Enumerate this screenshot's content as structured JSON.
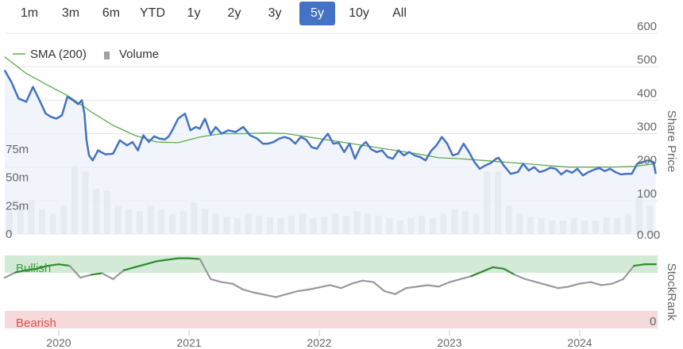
{
  "range_selector": {
    "buttons": [
      {
        "label": "1m",
        "active": false
      },
      {
        "label": "3m",
        "active": false
      },
      {
        "label": "6m",
        "active": false
      },
      {
        "label": "YTD",
        "active": false
      },
      {
        "label": "1y",
        "active": false
      },
      {
        "label": "2y",
        "active": false
      },
      {
        "label": "3y",
        "active": false
      },
      {
        "label": "5y",
        "active": true
      },
      {
        "label": "10y",
        "active": false
      },
      {
        "label": "All",
        "active": false
      }
    ]
  },
  "colors": {
    "price_line": "#4472c4",
    "price_fill": "#eef2fa",
    "sma_line": "#5aaa4a",
    "volume_bar": "#c8c8cc",
    "bullish_band": "#d3ebd6",
    "bearish_band": "#f6d9da",
    "bullish_text": "#3a9a3a",
    "bearish_text": "#d9534f",
    "rank_neutral": "#999999",
    "rank_bullish": "#2e8b2e",
    "grid": "#e6e6e6",
    "axis_text": "#666666"
  },
  "chart_data": [
    {
      "type": "line",
      "x_axis": {
        "ticks": [
          "2020",
          "2021",
          "2022",
          "2023",
          "2024"
        ],
        "range": [
          "2019-08",
          "2024-08"
        ]
      },
      "y_axis_right": {
        "title": "Share Price",
        "range": [
          0,
          600
        ],
        "ticks": [
          "0.00",
          "100",
          "200",
          "300",
          "400",
          "500",
          "600"
        ]
      },
      "y_axis_left": {
        "range": [
          0,
          100000000
        ],
        "ticks": [
          "0",
          "25m",
          "50m",
          "75m"
        ]
      },
      "legend": {
        "placement": "top-left",
        "items": [
          "SMA (200)",
          "Volume"
        ]
      },
      "grid": true,
      "series": [
        {
          "name": "Share Price",
          "kind": "area",
          "x": [
            "2019-08-01",
            "2019-08-20",
            "2019-09-10",
            "2019-10-01",
            "2019-10-20",
            "2019-11-10",
            "2019-11-25",
            "2019-12-10",
            "2019-12-25",
            "2020-01-10",
            "2020-01-25",
            "2020-02-10",
            "2020-02-25",
            "2020-03-05",
            "2020-03-12",
            "2020-03-18",
            "2020-03-25",
            "2020-04-05",
            "2020-04-20",
            "2020-05-10",
            "2020-06-01",
            "2020-06-20",
            "2020-07-10",
            "2020-07-25",
            "2020-08-10",
            "2020-08-25",
            "2020-09-10",
            "2020-09-25",
            "2020-10-10",
            "2020-10-25",
            "2020-11-05",
            "2020-11-15",
            "2020-12-01",
            "2020-12-20",
            "2021-01-05",
            "2021-01-20",
            "2021-02-01",
            "2021-02-15",
            "2021-03-01",
            "2021-03-15",
            "2021-04-01",
            "2021-04-20",
            "2021-05-10",
            "2021-06-01",
            "2021-06-20",
            "2021-07-10",
            "2021-07-25",
            "2021-08-10",
            "2021-08-25",
            "2021-09-10",
            "2021-09-25",
            "2021-10-10",
            "2021-10-25",
            "2021-11-10",
            "2021-11-25",
            "2021-12-10",
            "2021-12-25",
            "2022-01-10",
            "2022-01-25",
            "2022-02-10",
            "2022-02-25",
            "2022-03-10",
            "2022-03-25",
            "2022-04-10",
            "2022-04-25",
            "2022-05-10",
            "2022-05-25",
            "2022-06-10",
            "2022-06-25",
            "2022-07-10",
            "2022-07-25",
            "2022-08-10",
            "2022-08-25",
            "2022-09-10",
            "2022-09-25",
            "2022-10-10",
            "2022-10-25",
            "2022-11-10",
            "2022-11-25",
            "2022-12-10",
            "2022-12-25",
            "2023-01-10",
            "2023-01-25",
            "2023-02-10",
            "2023-02-25",
            "2023-03-10",
            "2023-03-25",
            "2023-04-10",
            "2023-04-25",
            "2023-05-10",
            "2023-05-17",
            "2023-06-01",
            "2023-06-20",
            "2023-07-10",
            "2023-07-25",
            "2023-08-10",
            "2023-08-25",
            "2023-09-10",
            "2023-09-25",
            "2023-10-10",
            "2023-10-25",
            "2023-11-10",
            "2023-11-25",
            "2023-12-10",
            "2023-12-25",
            "2024-01-10",
            "2024-01-25",
            "2024-02-10",
            "2024-02-25",
            "2024-03-10",
            "2024-03-25",
            "2024-04-10",
            "2024-04-25",
            "2024-05-10",
            "2024-05-25",
            "2024-06-10",
            "2024-06-25",
            "2024-07-10",
            "2024-07-25",
            "2024-08-01"
          ],
          "values": [
            490,
            455,
            405,
            395,
            440,
            395,
            360,
            350,
            345,
            355,
            410,
            400,
            388,
            400,
            360,
            280,
            235,
            220,
            250,
            238,
            240,
            280,
            265,
            275,
            250,
            295,
            275,
            292,
            285,
            283,
            292,
            310,
            345,
            360,
            310,
            320,
            315,
            345,
            298,
            320,
            300,
            310,
            305,
            320,
            295,
            285,
            270,
            270,
            275,
            285,
            290,
            285,
            270,
            290,
            282,
            260,
            255,
            280,
            300,
            270,
            273,
            245,
            270,
            225,
            260,
            275,
            253,
            245,
            250,
            230,
            225,
            250,
            235,
            245,
            235,
            230,
            220,
            248,
            265,
            290,
            270,
            235,
            240,
            270,
            245,
            215,
            195,
            205,
            212,
            225,
            228,
            205,
            180,
            185,
            210,
            190,
            200,
            185,
            190,
            198,
            195,
            178,
            190,
            183,
            195,
            175,
            185,
            192,
            197,
            188,
            195,
            185,
            178,
            180,
            180,
            210,
            215,
            220,
            215,
            180
          ]
        },
        {
          "name": "SMA (200)",
          "kind": "line",
          "x": [
            "2019-08-01",
            "2019-10-01",
            "2019-12-01",
            "2020-02-01",
            "2020-04-01",
            "2020-06-01",
            "2020-08-01",
            "2020-10-01",
            "2020-12-01",
            "2021-02-01",
            "2021-04-01",
            "2021-06-01",
            "2021-08-01",
            "2021-10-01",
            "2021-12-01",
            "2022-02-01",
            "2022-04-01",
            "2022-06-01",
            "2022-08-01",
            "2022-10-01",
            "2022-12-01",
            "2023-02-01",
            "2023-04-01",
            "2023-06-01",
            "2023-08-01",
            "2023-10-01",
            "2023-12-01",
            "2024-02-01",
            "2024-04-01",
            "2024-06-01",
            "2024-08-01"
          ],
          "values": [
            530,
            480,
            445,
            410,
            365,
            325,
            295,
            275,
            273,
            290,
            300,
            300,
            302,
            300,
            290,
            280,
            270,
            260,
            250,
            240,
            228,
            225,
            220,
            215,
            210,
            205,
            200,
            200,
            200,
            202,
            210
          ]
        },
        {
          "name": "Volume",
          "kind": "bar",
          "x": [
            "2019-08",
            "2019-09",
            "2019-10",
            "2019-11",
            "2019-12",
            "2020-01",
            "2020-02",
            "2020-03",
            "2020-04",
            "2020-05",
            "2020-06",
            "2020-07",
            "2020-08",
            "2020-09",
            "2020-10",
            "2020-11",
            "2020-12",
            "2021-01",
            "2021-02",
            "2021-03",
            "2021-04",
            "2021-05",
            "2021-06",
            "2021-07",
            "2021-08",
            "2021-09",
            "2021-10",
            "2021-11",
            "2021-12",
            "2022-01",
            "2022-02",
            "2022-03",
            "2022-04",
            "2022-05",
            "2022-06",
            "2022-07",
            "2022-08",
            "2022-09",
            "2022-10",
            "2022-11",
            "2022-12",
            "2023-01",
            "2023-02",
            "2023-03",
            "2023-04",
            "2023-05",
            "2023-06",
            "2023-07",
            "2023-08",
            "2023-09",
            "2023-10",
            "2023-11",
            "2023-12",
            "2024-01",
            "2024-02",
            "2024-03",
            "2024-04",
            "2024-05",
            "2024-06",
            "2024-07"
          ],
          "values": [
            20000000,
            25000000,
            30000000,
            22000000,
            18000000,
            25000000,
            60000000,
            55000000,
            40000000,
            38000000,
            25000000,
            22000000,
            20000000,
            25000000,
            22000000,
            18000000,
            20000000,
            28000000,
            22000000,
            18000000,
            15000000,
            14000000,
            18000000,
            16000000,
            15000000,
            14000000,
            16000000,
            18000000,
            14000000,
            15000000,
            18000000,
            16000000,
            20000000,
            18000000,
            16000000,
            14000000,
            12000000,
            14000000,
            16000000,
            14000000,
            18000000,
            22000000,
            20000000,
            18000000,
            55000000,
            55000000,
            25000000,
            18000000,
            15000000,
            14000000,
            12000000,
            12000000,
            14000000,
            12000000,
            12000000,
            15000000,
            14000000,
            18000000,
            32000000,
            25000000
          ]
        }
      ]
    },
    {
      "type": "line",
      "y_axis_right": {
        "title": "StockRank",
        "ticks": [
          "0"
        ],
        "range": [
          0,
          100
        ]
      },
      "bands": [
        {
          "label": "Bullish",
          "from": 70,
          "to": 100
        },
        {
          "label": "Bearish",
          "from": 0,
          "to": 20
        }
      ],
      "series": [
        {
          "name": "StockRank",
          "x": [
            "2019-08-01",
            "2019-09-01",
            "2019-10-01",
            "2019-11-01",
            "2019-12-01",
            "2020-01-01",
            "2020-02-01",
            "2020-03-01",
            "2020-04-01",
            "2020-05-01",
            "2020-06-01",
            "2020-07-01",
            "2020-08-01",
            "2020-09-01",
            "2020-10-01",
            "2020-11-01",
            "2020-12-01",
            "2021-01-01",
            "2021-02-01",
            "2021-03-01",
            "2021-04-01",
            "2021-05-01",
            "2021-06-01",
            "2021-07-01",
            "2021-08-01",
            "2021-09-01",
            "2021-10-01",
            "2021-11-01",
            "2021-12-01",
            "2022-01-01",
            "2022-02-01",
            "2022-03-01",
            "2022-04-01",
            "2022-05-01",
            "2022-06-01",
            "2022-07-01",
            "2022-08-01",
            "2022-09-01",
            "2022-10-01",
            "2022-11-01",
            "2022-12-01",
            "2023-01-01",
            "2023-02-01",
            "2023-03-01",
            "2023-04-01",
            "2023-05-01",
            "2023-06-01",
            "2023-07-01",
            "2023-08-01",
            "2023-09-01",
            "2023-10-01",
            "2023-11-01",
            "2023-12-01",
            "2024-01-01",
            "2024-02-01",
            "2024-03-01",
            "2024-04-01",
            "2024-05-01",
            "2024-06-01",
            "2024-07-01",
            "2024-08-01"
          ],
          "values": [
            68,
            75,
            78,
            80,
            84,
            86,
            84,
            68,
            72,
            74,
            66,
            78,
            82,
            86,
            90,
            92,
            94,
            94,
            93,
            66,
            62,
            60,
            52,
            48,
            45,
            42,
            46,
            50,
            52,
            55,
            58,
            54,
            60,
            64,
            62,
            50,
            46,
            54,
            56,
            58,
            56,
            62,
            66,
            70,
            76,
            82,
            80,
            72,
            66,
            62,
            58,
            54,
            56,
            60,
            62,
            58,
            60,
            66,
            84,
            86,
            86
          ]
        }
      ]
    }
  ]
}
